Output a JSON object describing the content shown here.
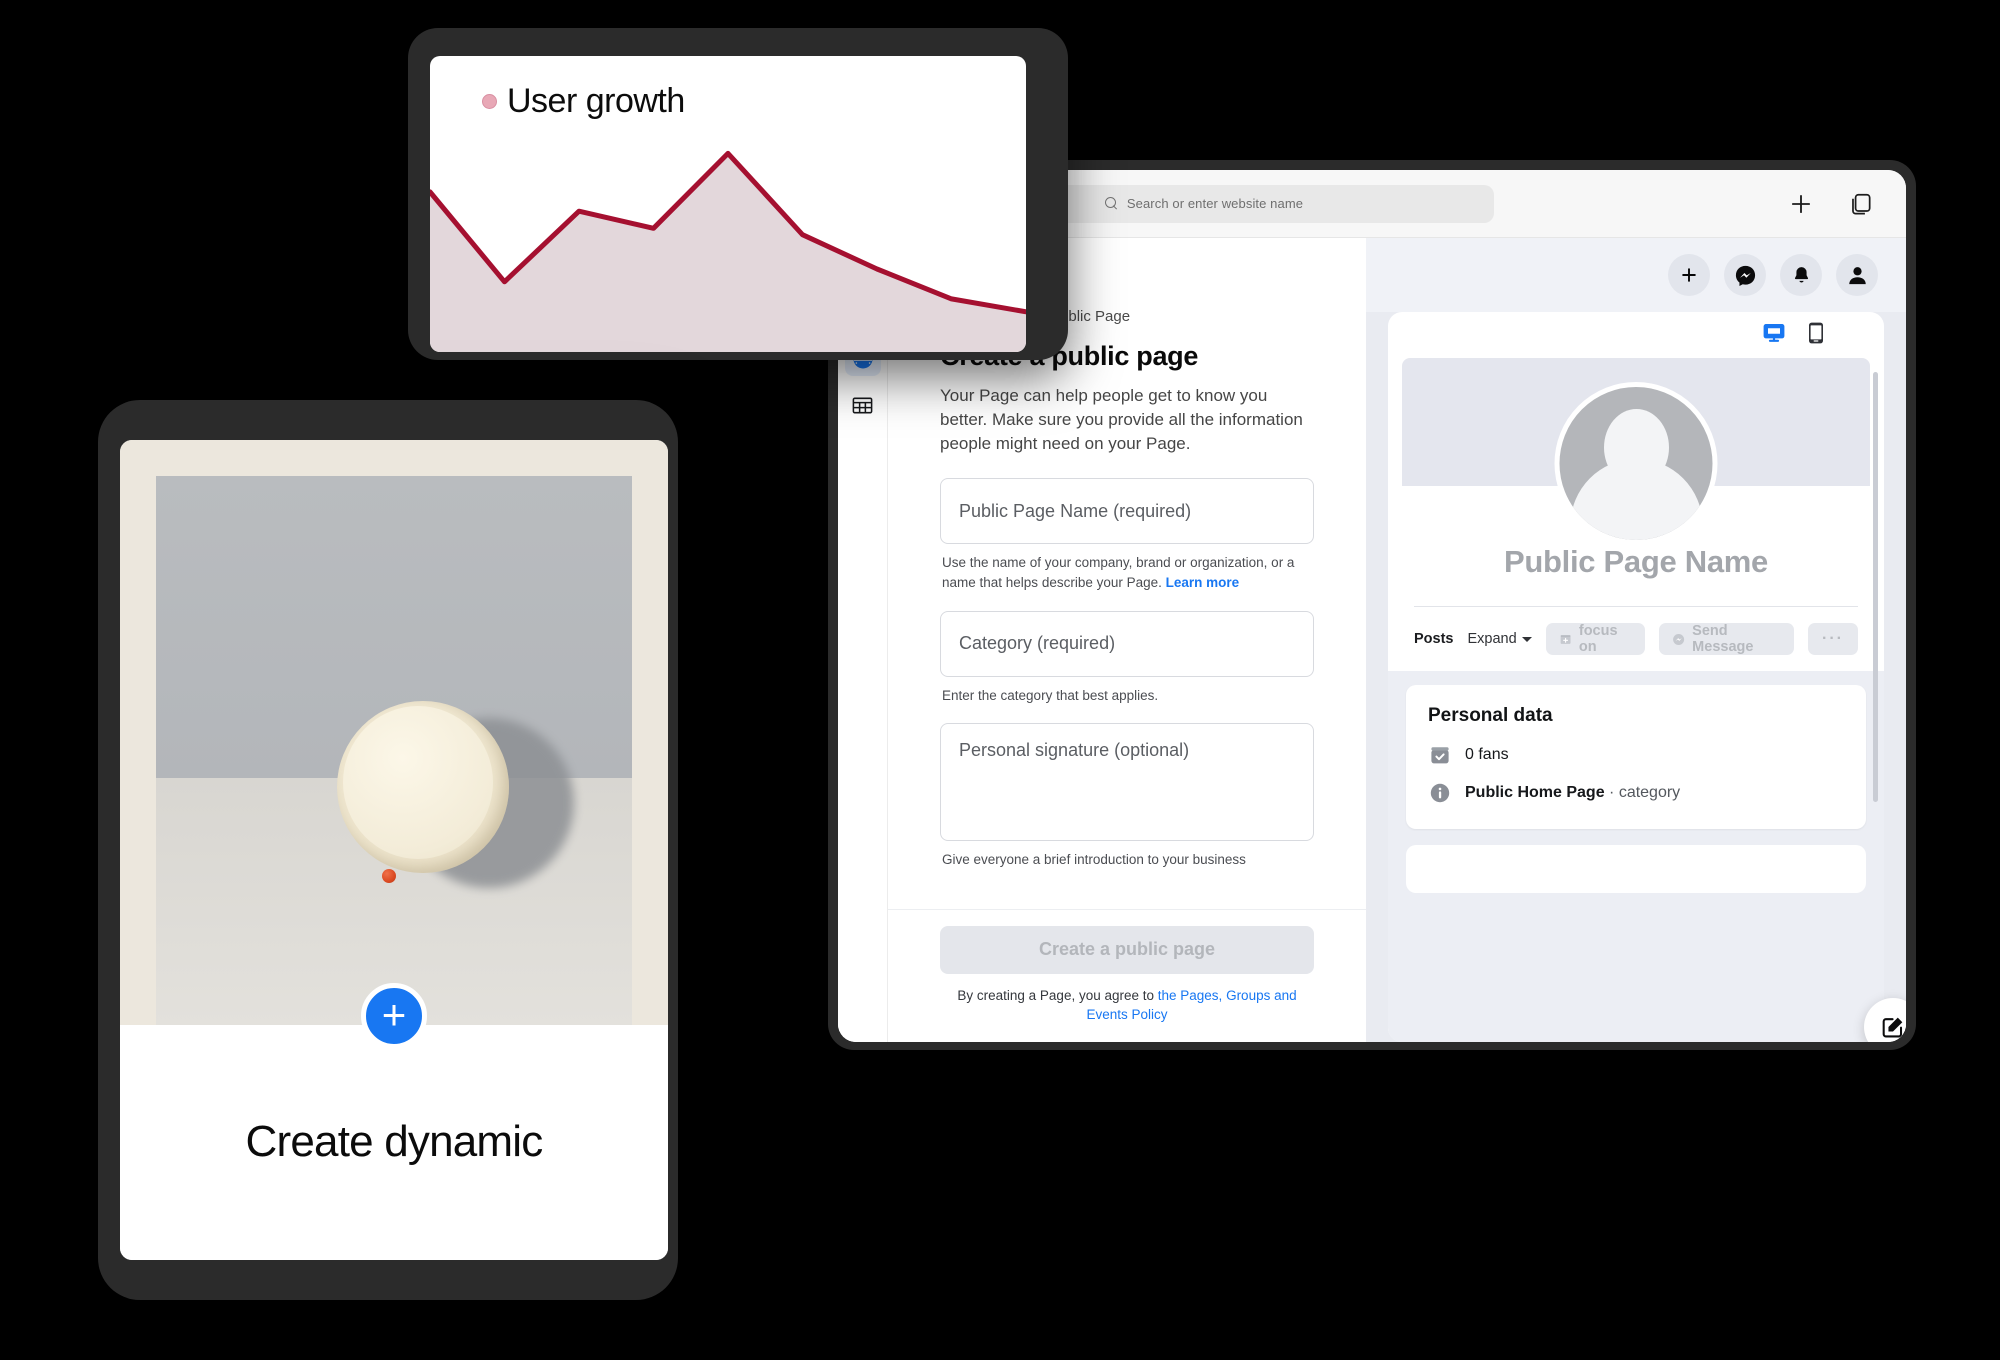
{
  "browser": {
    "omnibox_placeholder": "Search or enter website name",
    "new_tab_label": "+",
    "tabs_icon": "copy-tabs-icon",
    "search_icon": "search-icon"
  },
  "app_rail": {
    "items": [
      {
        "icon": "dashboard-icon",
        "active": true
      },
      {
        "icon": "table-grid-icon",
        "active": false
      }
    ]
  },
  "top_actions": {
    "create": "+",
    "messenger": "messenger-icon",
    "notifications": "bell-icon",
    "account": "account-avatar-icon"
  },
  "form": {
    "breadcrumb": "Public Page",
    "title": "Create a public page",
    "description": "Your Page can help people get to know you better. Make sure you provide all the information people might need on your Page.",
    "fields": [
      {
        "placeholder": "Public Page Name (required)",
        "helper": "Use the name of your company, brand or organization, or a name that helps describe your Page.",
        "helper_link": "Learn more"
      },
      {
        "placeholder": "Category (required)",
        "helper": "Enter the category that best applies.",
        "helper_link": ""
      },
      {
        "placeholder": "Personal signature (optional)",
        "helper": "Give everyone a brief introduction to your business",
        "helper_link": ""
      }
    ],
    "submit_label": "Create a public page",
    "legal_prefix": "By creating a Page, you agree to ",
    "legal_link": "the Pages, Groups and Events Policy"
  },
  "preview": {
    "devices": [
      {
        "name": "desktop-view",
        "active": true
      },
      {
        "name": "mobile-view",
        "active": false
      }
    ],
    "page_name": "Public Page Name",
    "tabs": {
      "posts": "Posts",
      "expand": "Expand"
    },
    "buttons": {
      "focus_on": "focus on",
      "send_message": "Send Message",
      "more": "···"
    },
    "data_card": {
      "title": "Personal data",
      "rows": [
        {
          "icon": "verified-box-icon",
          "text": "0 fans",
          "muted": ""
        },
        {
          "icon": "info-icon",
          "text": "Public Home Page",
          "muted": " · category"
        }
      ]
    },
    "edit_icon": "edit-pencil-icon"
  },
  "photo_card": {
    "caption": "Create dynamic",
    "add_button": "+",
    "image_alt": "cream-bowl-with-red-berry-photo"
  },
  "colors": {
    "accent_blue": "#1877f2",
    "chart_line": "#a51030",
    "chart_fill": "#e3d7db",
    "legend_dot": "#e8a8b6",
    "disabled_button": "#e4e6eb"
  },
  "chart_data": {
    "type": "area",
    "title": "User growth",
    "legend": [
      "User growth"
    ],
    "legend_position": "top-left",
    "xlabel": "",
    "ylabel": "",
    "grid": false,
    "x": [
      0,
      1,
      2,
      3,
      4,
      5,
      6,
      7,
      8
    ],
    "values": [
      72,
      30,
      63,
      55,
      90,
      52,
      36,
      22,
      16
    ],
    "ylim": [
      0,
      100
    ],
    "series": [
      {
        "name": "User growth",
        "values": [
          72,
          30,
          63,
          55,
          90,
          52,
          36,
          22,
          16
        ]
      }
    ],
    "line_color": "#a51030",
    "fill_color": "#e3d7db"
  }
}
